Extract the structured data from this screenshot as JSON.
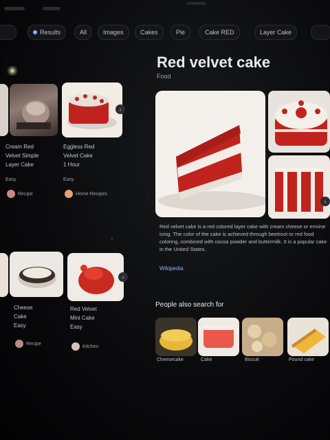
{
  "search": {
    "tabs": [
      {
        "label": "Results"
      },
      {
        "label": "All"
      },
      {
        "label": "Images"
      },
      {
        "label": "Cakes"
      },
      {
        "label": "Pie"
      },
      {
        "label": "Cake RED"
      },
      {
        "label": "Layer Cake"
      }
    ]
  },
  "grid": {
    "row1": [
      {
        "caption1": "Cream Red",
        "caption2": "Velvet Simple",
        "caption3": "Layer Cake",
        "meta": "Easy",
        "source": "Recipe"
      },
      {
        "caption1": "Eggless Red",
        "caption2": "Velvet Cake",
        "caption3": "1 Hour",
        "meta": "Easy",
        "source": "Home Recipes"
      }
    ],
    "row2": [
      {
        "caption1": "Cheese",
        "caption2": "Cake",
        "caption3": "Easy",
        "meta": "",
        "source": "Recipe"
      },
      {
        "caption1": "Red Velvet",
        "caption2": "Mini Cake",
        "caption3": "Easy",
        "meta": "",
        "source": "Kitchen"
      }
    ]
  },
  "knowledge_panel": {
    "title": "Red velvet cake",
    "subtitle": "Food",
    "description": "Red velvet cake is a red colored layer cake with cream cheese or ermine icing. The color of the cake is achieved through beetroot or red food coloring, combined with cocoa powder and buttermilk. It is a popular cake in the United States.",
    "more_label": "Wikipedia"
  },
  "people_also_search": {
    "heading": "People also search for",
    "items": [
      {
        "label": "Cheesecake"
      },
      {
        "label": "Cake"
      },
      {
        "label": "Biscuit"
      },
      {
        "label": "Pound cake"
      }
    ]
  },
  "colors": {
    "background": "#050506",
    "accent_link": "#8ab4f8",
    "cake_red": "#c0231e",
    "frosting": "#f2ede6"
  }
}
